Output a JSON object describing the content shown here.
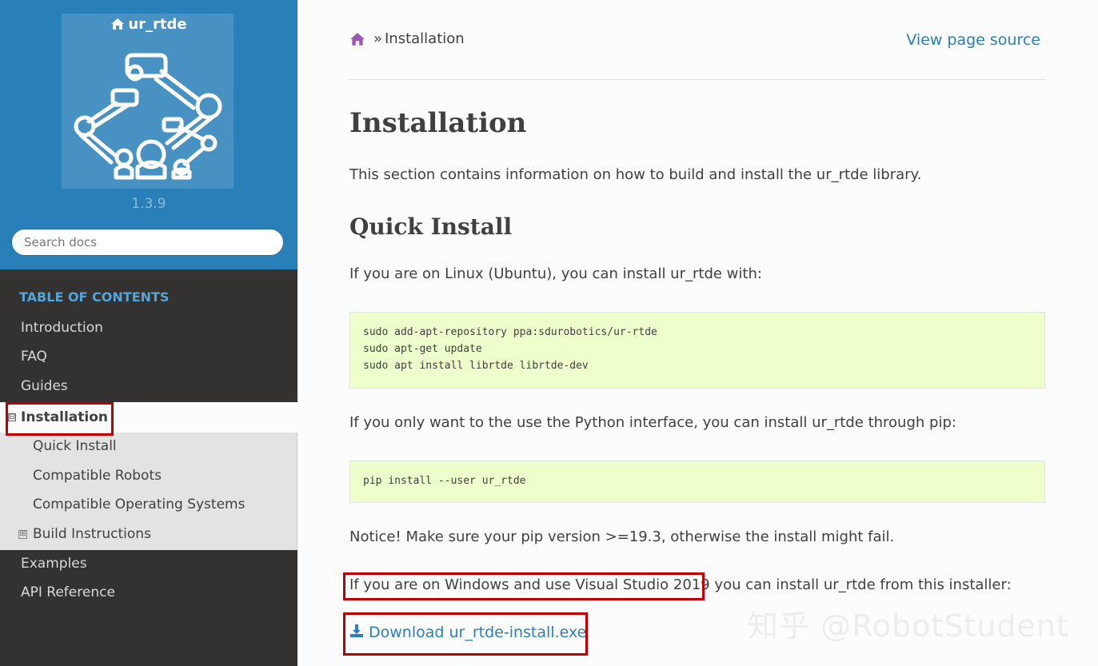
{
  "sidebar": {
    "project_title": "ur_rtde",
    "version": "1.3.9",
    "search_placeholder": "Search docs",
    "toc_caption": "TABLE OF CONTENTS",
    "items": [
      {
        "label": "Introduction"
      },
      {
        "label": "FAQ"
      },
      {
        "label": "Guides"
      },
      {
        "label": "Installation"
      },
      {
        "label": "Examples"
      },
      {
        "label": "API Reference"
      }
    ],
    "subitems": [
      {
        "label": "Quick Install"
      },
      {
        "label": "Compatible Robots"
      },
      {
        "label": "Compatible Operating Systems"
      },
      {
        "label": "Build Instructions"
      }
    ],
    "toggle_expanded": "⊟",
    "toggle_collapsed": "⊞"
  },
  "breadcrumb": {
    "separator": "»",
    "current": "Installation"
  },
  "view_source": "View page source",
  "content": {
    "title": "Installation",
    "intro": "This section contains information on how to build and install the ur_rtde library.",
    "section_title": "Quick Install",
    "linux_text": "If you are on Linux (Ubuntu), you can install ur_rtde with:",
    "linux_code": "sudo add-apt-repository ppa:sdurobotics/ur-rtde\nsudo apt-get update\nsudo apt install librtde librtde-dev",
    "pip_text": "If you only want to the use the Python interface, you can install ur_rtde through pip:",
    "pip_code": "pip install --user ur_rtde",
    "notice": "Notice! Make sure your pip version >=19.3, otherwise the install might fail.",
    "windows_text_part1": "If you are on Windows and use Visual Studio 2019",
    "windows_text_part2": " you can install ur_rtde from this installer:",
    "download_link": "Download ur_rtde-install.exe"
  },
  "watermark": "知乎 @RobotStudent",
  "colors": {
    "sidebar_top": "#2980b9",
    "sidebar_bg": "#343131",
    "link": "#2980b9",
    "code_bg": "#eeffcc",
    "annotation": "#c00000",
    "breadcrumb_home": "#9b59b6"
  }
}
